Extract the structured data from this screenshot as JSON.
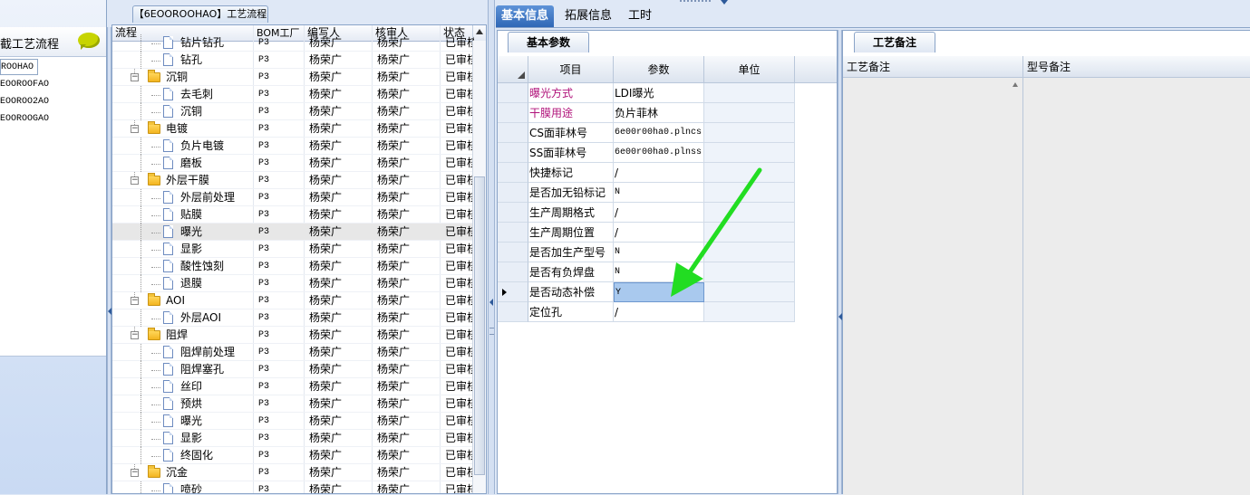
{
  "left": {
    "header_title": "截工艺流程",
    "items": [
      "ROOHAO",
      "EOOROOFAO",
      "EOOROO2AO",
      "EOOROOGAO"
    ]
  },
  "tree": {
    "title": "【6EOOROOHAO】工艺流程",
    "columns": [
      "流程",
      "BOM工厂",
      "编写人",
      "核审人",
      "状态"
    ],
    "rows": [
      {
        "level": 1,
        "type": "doc",
        "name": "钻片钻孔",
        "bom": "P3",
        "writer": "杨荣广",
        "checker": "杨荣广",
        "status": "已审核"
      },
      {
        "level": 1,
        "type": "doc",
        "name": "钻孔",
        "bom": "P3",
        "writer": "杨荣广",
        "checker": "杨荣广",
        "status": "已审核"
      },
      {
        "level": 0,
        "type": "folder",
        "name": "沉铜",
        "bom": "P3",
        "writer": "杨荣广",
        "checker": "杨荣广",
        "status": "已审核"
      },
      {
        "level": 1,
        "type": "doc",
        "name": "去毛刺",
        "bom": "P3",
        "writer": "杨荣广",
        "checker": "杨荣广",
        "status": "已审核"
      },
      {
        "level": 1,
        "type": "doc",
        "name": "沉铜",
        "bom": "P3",
        "writer": "杨荣广",
        "checker": "杨荣广",
        "status": "已审核"
      },
      {
        "level": 0,
        "type": "folder",
        "name": "电镀",
        "bom": "P3",
        "writer": "杨荣广",
        "checker": "杨荣广",
        "status": "已审核"
      },
      {
        "level": 1,
        "type": "doc",
        "name": "负片电镀",
        "bom": "P3",
        "writer": "杨荣广",
        "checker": "杨荣广",
        "status": "已审核"
      },
      {
        "level": 1,
        "type": "doc",
        "name": "磨板",
        "bom": "P3",
        "writer": "杨荣广",
        "checker": "杨荣广",
        "status": "已审核"
      },
      {
        "level": 0,
        "type": "folder",
        "name": "外层干膜",
        "bom": "P3",
        "writer": "杨荣广",
        "checker": "杨荣广",
        "status": "已审核"
      },
      {
        "level": 1,
        "type": "doc",
        "name": "外层前处理",
        "bom": "P3",
        "writer": "杨荣广",
        "checker": "杨荣广",
        "status": "已审核"
      },
      {
        "level": 1,
        "type": "doc",
        "name": "贴膜",
        "bom": "P3",
        "writer": "杨荣广",
        "checker": "杨荣广",
        "status": "已审核"
      },
      {
        "level": 1,
        "type": "doc",
        "name": "曝光",
        "bom": "P3",
        "writer": "杨荣广",
        "checker": "杨荣广",
        "status": "已审核",
        "highlight": true
      },
      {
        "level": 1,
        "type": "doc",
        "name": "显影",
        "bom": "P3",
        "writer": "杨荣广",
        "checker": "杨荣广",
        "status": "已审核"
      },
      {
        "level": 1,
        "type": "doc",
        "name": "酸性蚀刻",
        "bom": "P3",
        "writer": "杨荣广",
        "checker": "杨荣广",
        "status": "已审核"
      },
      {
        "level": 1,
        "type": "doc",
        "name": "退膜",
        "bom": "P3",
        "writer": "杨荣广",
        "checker": "杨荣广",
        "status": "已审核"
      },
      {
        "level": 0,
        "type": "folder",
        "name": "AOI",
        "bom": "P3",
        "writer": "杨荣广",
        "checker": "杨荣广",
        "status": "已审核"
      },
      {
        "level": 1,
        "type": "doc",
        "name": "外层AOI",
        "bom": "P3",
        "writer": "杨荣广",
        "checker": "杨荣广",
        "status": "已审核"
      },
      {
        "level": 0,
        "type": "folder",
        "name": "阻焊",
        "bom": "P3",
        "writer": "杨荣广",
        "checker": "杨荣广",
        "status": "已审核"
      },
      {
        "level": 1,
        "type": "doc",
        "name": "阻焊前处理",
        "bom": "P3",
        "writer": "杨荣广",
        "checker": "杨荣广",
        "status": "已审核"
      },
      {
        "level": 1,
        "type": "doc",
        "name": "阻焊塞孔",
        "bom": "P3",
        "writer": "杨荣广",
        "checker": "杨荣广",
        "status": "已审核"
      },
      {
        "level": 1,
        "type": "doc",
        "name": "丝印",
        "bom": "P3",
        "writer": "杨荣广",
        "checker": "杨荣广",
        "status": "已审核"
      },
      {
        "level": 1,
        "type": "doc",
        "name": "预烘",
        "bom": "P3",
        "writer": "杨荣广",
        "checker": "杨荣广",
        "status": "已审核"
      },
      {
        "level": 1,
        "type": "doc",
        "name": "曝光",
        "bom": "P3",
        "writer": "杨荣广",
        "checker": "杨荣广",
        "status": "已审核"
      },
      {
        "level": 1,
        "type": "doc",
        "name": "显影",
        "bom": "P3",
        "writer": "杨荣广",
        "checker": "杨荣广",
        "status": "已审核"
      },
      {
        "level": 1,
        "type": "doc",
        "name": "终固化",
        "bom": "P3",
        "writer": "杨荣广",
        "checker": "杨荣广",
        "status": "已审核"
      },
      {
        "level": 0,
        "type": "folder",
        "name": "沉金",
        "bom": "P3",
        "writer": "杨荣广",
        "checker": "杨荣广",
        "status": "已审核"
      },
      {
        "level": 1,
        "type": "doc",
        "name": "喷砂",
        "bom": "P3",
        "writer": "杨荣广",
        "checker": "杨荣广",
        "status": "已审核"
      }
    ]
  },
  "tabs": [
    "基本信息",
    "拓展信息",
    "工时"
  ],
  "basic": {
    "subtab": "基本参数",
    "columns": [
      "项目",
      "参数",
      "单位"
    ],
    "rows": [
      {
        "item": "曝光方式",
        "value": "LDI曝光",
        "unit": "",
        "color": "#b0127a"
      },
      {
        "item": "干膜用途",
        "value": "负片菲林",
        "unit": "",
        "color": "#b0127a"
      },
      {
        "item": "CS面菲林号",
        "value": "6e00r00ha0.plncs",
        "unit": "",
        "mono": true
      },
      {
        "item": "SS面菲林号",
        "value": "6e00r00ha0.plnss",
        "unit": "",
        "mono": true
      },
      {
        "item": "快捷标记",
        "value": "/",
        "unit": ""
      },
      {
        "item": "是否加无铅标记",
        "value": "N",
        "unit": "",
        "mono": true
      },
      {
        "item": "生产周期格式",
        "value": "/",
        "unit": ""
      },
      {
        "item": "生产周期位置",
        "value": "/",
        "unit": ""
      },
      {
        "item": "是否加生产型号",
        "value": "N",
        "unit": "",
        "mono": true
      },
      {
        "item": "是否有负焊盘",
        "value": "N",
        "unit": "",
        "mono": true
      },
      {
        "item": "是否动态补偿",
        "value": "Y",
        "unit": "",
        "mono": true,
        "selected": true,
        "current": true
      },
      {
        "item": "定位孔",
        "value": "/",
        "unit": ""
      }
    ]
  },
  "notes": {
    "subtab": "工艺备注",
    "col1": "工艺备注",
    "col2": "型号备注"
  },
  "colors": {
    "accent_tab": "#2f67b6",
    "selected_cell": "#a9c9ee",
    "annotation_arrow": "#22dd22"
  }
}
